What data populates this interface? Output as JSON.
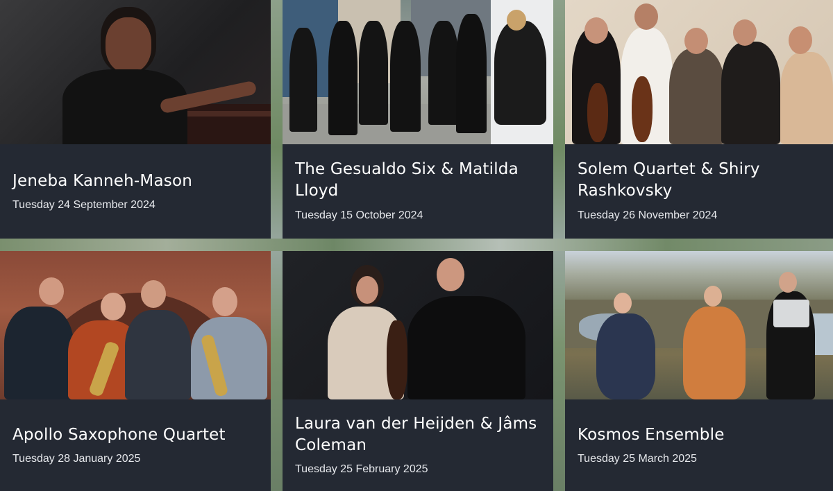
{
  "events": [
    {
      "name": "Jeneba Kanneh-Mason",
      "date": "Tuesday 24 September 2024"
    },
    {
      "name": "The Gesualdo Six & Matilda Lloyd",
      "date": "Tuesday 15 October 2024"
    },
    {
      "name": "Solem Quartet & Shiry Rashkovsky",
      "date": "Tuesday 26 November 2024"
    },
    {
      "name": "Apollo Saxophone Quartet",
      "date": "Tuesday 28 January 2025"
    },
    {
      "name": "Laura van der Heijden & Jâms Coleman",
      "date": "Tuesday 25 February 2025"
    },
    {
      "name": "Kosmos Ensemble",
      "date": "Tuesday 25 March 2025"
    }
  ],
  "colors": {
    "card_bg": "#242933",
    "title_text": "#ffffff",
    "date_text": "#e6e8ec"
  }
}
